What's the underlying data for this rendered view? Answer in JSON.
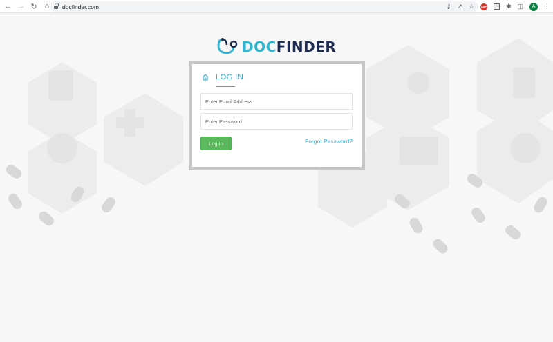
{
  "browser": {
    "url": "docfinder.com",
    "profile_initial": "A",
    "ext_badge": "ABP"
  },
  "logo": {
    "part1": "DOC",
    "part2": "FINDER"
  },
  "login": {
    "title": "LOG IN",
    "email_placeholder": "Enter Email Address",
    "password_placeholder": "Enter Password",
    "button_label": "Log In",
    "forgot_label": "Forgot Password?"
  },
  "colors": {
    "accent": "#2fa9d6",
    "brand_dark": "#1d2a4f",
    "button_green": "#5cb85c"
  }
}
